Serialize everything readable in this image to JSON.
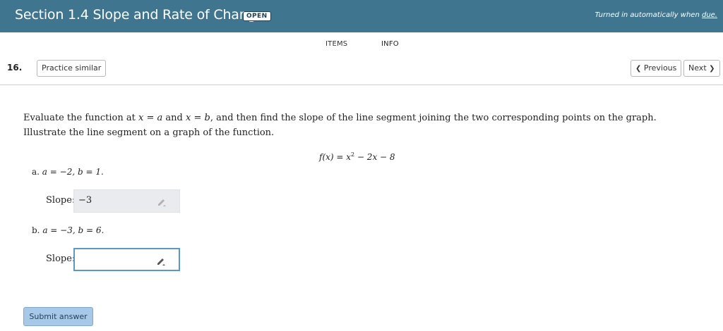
{
  "header": {
    "title": "Section 1.4 Slope and Rate of Change",
    "badge": "OPEN",
    "due_prefix": "Turned in automatically when ",
    "due_link": "due."
  },
  "tabs": [
    {
      "label": "ITEMS"
    },
    {
      "label": "INFO"
    }
  ],
  "question": {
    "number": "16.",
    "practice_label": "Practice similar",
    "previous_label": "Previous",
    "next_label": "Next",
    "prompt": {
      "p1": "Evaluate the function at ",
      "x1": "x",
      "p2": " = ",
      "a1": "a",
      "p3": " and ",
      "x2": "x",
      "p4": " = ",
      "b1": "b",
      "p5": ", and then find the slope of the line segment joining the two corresponding points on the graph. Illustrate the line segment on a graph of the function."
    },
    "formula": {
      "lhs": "f(x) = x",
      "exp": "2",
      "rhs": " − 2x − 8"
    },
    "parts": [
      {
        "label": "a.",
        "condition": "a = −2, b = 1.",
        "slope_label": "Slope:",
        "answer": "−3"
      },
      {
        "label": "b.",
        "condition": "a = −3, b = 6.",
        "slope_label": "Slope:",
        "answer": ""
      }
    ],
    "submit_label": "Submit answer"
  },
  "icons": {
    "pencil": "pencil-icon",
    "chevron_left": "chevron-left-icon",
    "chevron_right": "chevron-right-icon"
  },
  "colors": {
    "header_bg": "#3f758f",
    "submit_bg": "#a8c8e8",
    "active_input_border": "#5b97c7",
    "locked_input_bg": "#e9ebee"
  }
}
